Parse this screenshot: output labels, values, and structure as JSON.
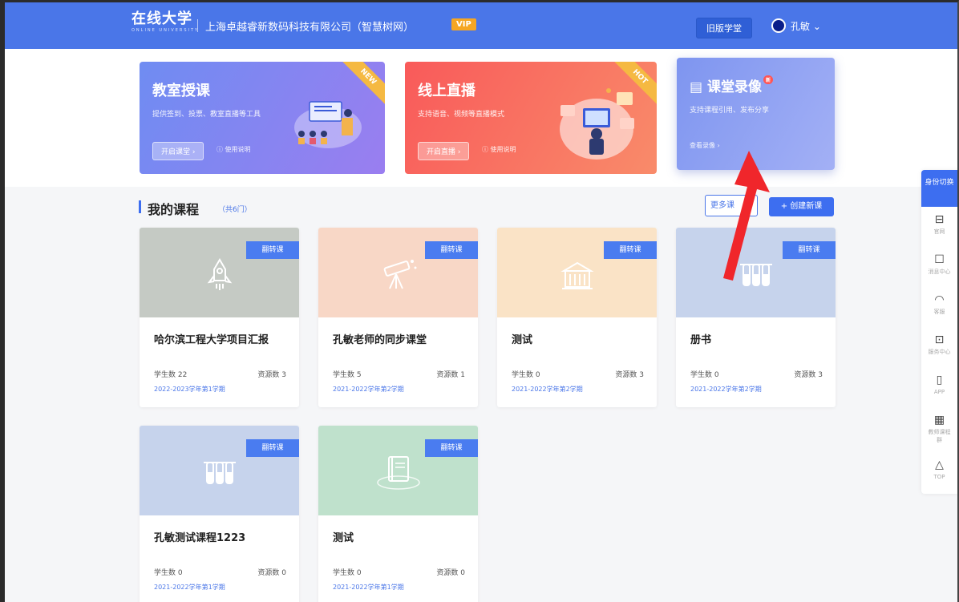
{
  "header": {
    "logo": "在线大学",
    "logo_sub": "ONLINE UNIVERSITY",
    "org_name": "上海卓越睿新数码科技有限公司（智慧树网）",
    "vip": "VIP",
    "old_button": "旧版学堂",
    "user_name": "孔敏 ⌄"
  },
  "features": [
    {
      "title": "教室授课",
      "desc": "提供签到、投票、教室直播等工具",
      "button": "开启课堂 ›",
      "link": "ⓘ 使用说明",
      "ribbon": "NEW",
      "color": "#7d87f1"
    },
    {
      "title": "线上直播",
      "desc": "支持语音、视频等直播模式",
      "button": "开启直播 ›",
      "link": "ⓘ 使用说明",
      "ribbon": "HOT",
      "color": "#f96a60"
    },
    {
      "title": "课堂录像",
      "new_tag": "新",
      "desc": "支持课程引用、发布分享",
      "link": "查看录像 ›",
      "color": "#8fa2f2"
    }
  ],
  "section": {
    "title": "我的课程",
    "count": "（共6门）",
    "more": "更多课",
    "create": "+ 创建新课"
  },
  "courses": [
    {
      "tag": "翻转课",
      "title": "哈尔滨工程大学项目汇报",
      "students": "学生数 22",
      "resources": "资源数 3",
      "term": "2022-2023学年第1学期",
      "cover": "#c5cac4",
      "icon": "rocket-icon"
    },
    {
      "tag": "翻转课",
      "title": "孔敏老师的同步课堂",
      "students": "学生数 5",
      "resources": "资源数 1",
      "term": "2021-2022学年第2学期",
      "cover": "#f8d7c6",
      "icon": "telescope-icon"
    },
    {
      "tag": "翻转课",
      "title": "测试",
      "students": "学生数 0",
      "resources": "资源数 3",
      "term": "2021-2022学年第2学期",
      "cover": "#fae3c6",
      "icon": "building-icon"
    },
    {
      "tag": "翻转课",
      "title": "册书",
      "students": "学生数 0",
      "resources": "资源数 3",
      "term": "2021-2022学年第2学期",
      "cover": "#c6d3ec",
      "icon": "test-tube-icon"
    },
    {
      "tag": "翻转课",
      "title": "孔敏测试课程1223",
      "students": "学生数 0",
      "resources": "资源数 0",
      "term": "2021-2022学年第1学期",
      "cover": "#c6d3ec",
      "icon": "test-tube-icon"
    },
    {
      "tag": "翻转课",
      "title": "测试",
      "students": "学生数 0",
      "resources": "资源数 0",
      "term": "2021-2022学年第1学期",
      "cover": "#bfe1cc",
      "icon": "book-icon"
    }
  ],
  "sidebar": {
    "switch": "身份切换",
    "items": [
      {
        "glyph": "⊟",
        "label": "官网",
        "icon": "website-icon"
      },
      {
        "glyph": "☐",
        "label": "消息中心",
        "icon": "message-icon"
      },
      {
        "glyph": "◠",
        "label": "客服",
        "icon": "headset-icon"
      },
      {
        "glyph": "⊡",
        "label": "服务中心",
        "icon": "service-icon"
      },
      {
        "glyph": "▯",
        "label": "APP",
        "icon": "phone-icon"
      },
      {
        "glyph": "▦",
        "label": "教师课程群",
        "icon": "qrcode-icon"
      },
      {
        "glyph": "△",
        "label": "TOP",
        "icon": "top-icon"
      }
    ]
  },
  "colors": {
    "primary": "#4a76e8",
    "arrow": "#f0262b"
  }
}
